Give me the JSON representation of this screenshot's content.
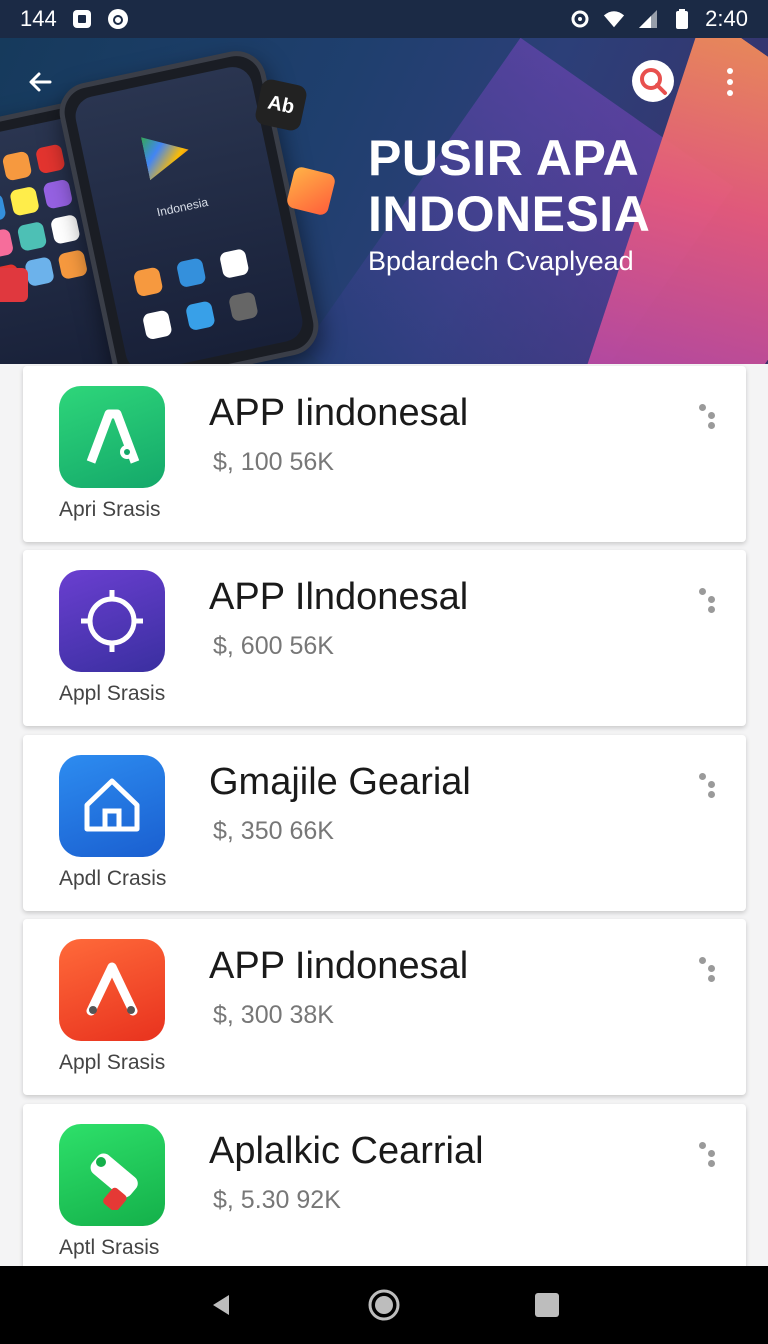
{
  "status_bar": {
    "left_text": "144",
    "time": "2:40",
    "icons": [
      "notification-icon",
      "clock-app-icon",
      "settings-icon",
      "wifi-icon",
      "signal-icon",
      "battery-icon"
    ]
  },
  "hero": {
    "title_line1": "PUSIR APA",
    "title_line2": "INDONESIA",
    "subtitle": "Bpdardech Cvaplyead",
    "badge_text": "Ab",
    "phone_label": "Indonesia",
    "icons": [
      "back-arrow-icon",
      "search-icon",
      "more-vert-icon"
    ]
  },
  "apps": [
    {
      "title": "APP Iindonesal",
      "price": "$, 100 56K",
      "caption": "Apri Srasis",
      "icon": "aptoide-icon",
      "color_from": "#2ed67a",
      "color_to": "#14a86a"
    },
    {
      "title": "APP Ilndonesal",
      "price": "$, 600 56K",
      "caption": "Appl Srasis",
      "icon": "circle-gear-icon",
      "color_from": "#6a3fd0",
      "color_to": "#3a2fa0"
    },
    {
      "title": "Gmajile Gearial",
      "price": "$, 350 66K",
      "caption": "Apdl Crasis",
      "icon": "home-icon",
      "color_from": "#2d8cf0",
      "color_to": "#1a5fd0"
    },
    {
      "title": "APP Iindonesal",
      "price": "$, 300 38K",
      "caption": "Appl Srasis",
      "icon": "compass-icon",
      "color_from": "#ff6a3a",
      "color_to": "#e8321e"
    },
    {
      "title": "Aplalkic Cearrial",
      "price": "$, 5.30 92K",
      "caption": "Aptl Srasis",
      "icon": "tag-icon",
      "color_from": "#2ee06a",
      "color_to": "#14b04a"
    }
  ],
  "nav_bar": {
    "icons": [
      "back-triangle-icon",
      "home-circle-icon",
      "recents-square-icon"
    ]
  }
}
